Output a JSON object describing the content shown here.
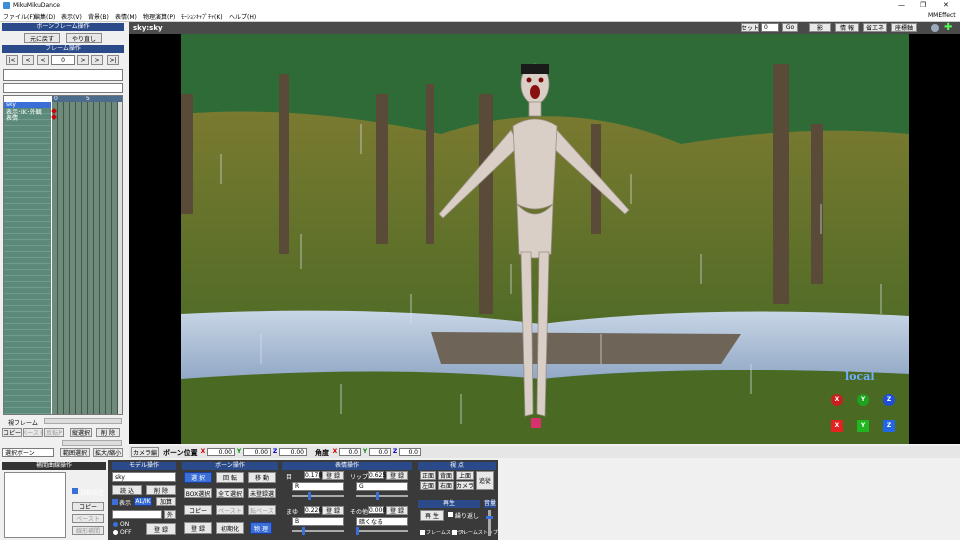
{
  "window": {
    "title": "MikuMikuDance",
    "controls": [
      "—",
      "❐",
      "✕"
    ]
  },
  "menu": [
    "ファイル(F)",
    "編集(D)",
    "表示(V)",
    "背景(B)",
    "表情(M)",
    "物理演算(P)",
    "ﾓｰｼｮﾝｷｬﾌﾟﾁｬ(K)",
    "ヘルプ(H)"
  ],
  "menu_right": "MMEffect",
  "left_panel": {
    "bone_frame_header": "ボーンフレーム操作",
    "undo": "元に戻す",
    "redo": "やり直し",
    "frame_header": "フレーム操作",
    "nav_buttons": [
      "|<",
      "<",
      "<",
      ">",
      ">",
      ">|"
    ],
    "frame_value": "0",
    "timeline_markers": [
      "0",
      "5"
    ],
    "tracks": [
      "sky",
      "表示･IK･外観",
      "表情"
    ],
    "range_label": "範囲選択",
    "view_frame_label": "視フレーム",
    "copy": "コピー",
    "paste": "ペースト",
    "reverse_paste": "反転P",
    "column_select": "縦選択",
    "delete": "削 除",
    "bone_select": "選択ボーン",
    "range_select": "範囲選択",
    "expand": "拡大/縮小"
  },
  "viewport": {
    "model_label": "sky:sky",
    "toolbar": {
      "seto": "セット",
      "value": "0",
      "go": "Go",
      "shadow": "影",
      "info": "情 報",
      "local": "省エネ",
      "axis": "座標軸"
    },
    "local_label": "local",
    "rot_axes": [
      "X",
      "Y",
      "Z"
    ],
    "move_axes": [
      "X",
      "Y",
      "Z"
    ]
  },
  "status_bar": {
    "camera_tab": "カメラ編",
    "bone_pos_label": "ボーン位置",
    "pos": {
      "x": "0.00",
      "y": "0.00",
      "z": "0.00"
    },
    "angle_label": "角度",
    "rot": {
      "x": "0.0",
      "y": "0.0",
      "z": "0.0"
    }
  },
  "interp": {
    "header": "補間曲線操作",
    "auto": "自動設定",
    "copy": "コピー",
    "paste": "ペースト",
    "linear": "線形補間"
  },
  "model_ops": {
    "header": "モデル操作",
    "model": "sky",
    "load": "読 込",
    "delete": "削 除",
    "show": "表示",
    "ik": "AL/IK",
    "add": "加算",
    "outside": "外",
    "on": "ON",
    "off": "OFF",
    "register": "登 録"
  },
  "bone_ops": {
    "header": "ボーン操作",
    "select": "選 択",
    "rotate": "回 転",
    "move": "移 動",
    "box_select": "BOX選択",
    "select_all": "全て選択",
    "unregistered": "未登録選",
    "copy": "コピー",
    "paste": "ペースト",
    "reverse_paste": "反転ペースト",
    "register": "登 録",
    "init": "初期化",
    "physics": "物 理"
  },
  "morph_ops": {
    "header": "表情操作",
    "eye_label": "目",
    "eye_val": "0.178",
    "eye_reg": "登 録",
    "eye_sel": "R",
    "lip_label": "リップ",
    "lip_val": "0.625",
    "lip_reg": "登 録",
    "lip_sel": "G",
    "brow_label": "まゆ",
    "brow_val": "0.226",
    "brow_reg": "登 録",
    "brow_sel": "B",
    "other_label": "その他",
    "other_val": "0.000",
    "other_reg": "登 録",
    "other_sel": "暗くなる"
  },
  "view_ops": {
    "header": "視 点",
    "front": "正面",
    "back": "背面",
    "top": "上面",
    "left": "左面",
    "right": "右面",
    "camera": "カメラ",
    "follow": "追従",
    "play_header": "再生",
    "play": "再 生",
    "repeat": "繰り返し",
    "frame_start": "フレームスタート",
    "frame_stop": "フレームストップ",
    "vol": "音量"
  },
  "colors": {
    "accent": "#2b4a8a",
    "viewport_bg": "#000000",
    "select_blue": "#3b6fd8"
  }
}
